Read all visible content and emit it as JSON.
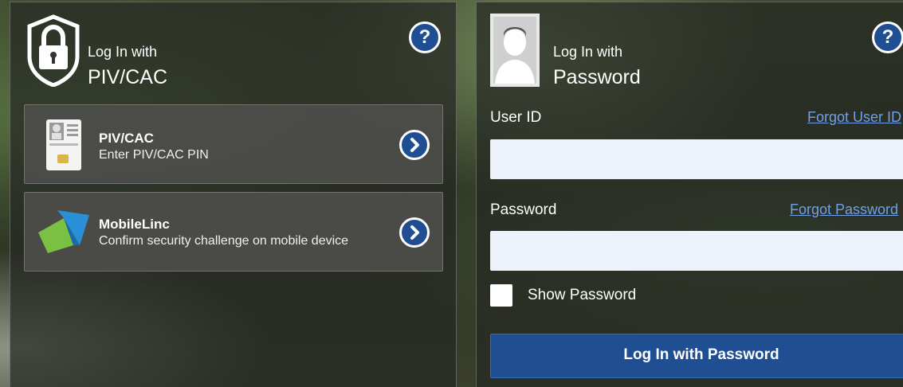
{
  "piv_panel": {
    "heading_small": "Log In with",
    "heading_large": "PIV/CAC",
    "help_icon": "?",
    "options": [
      {
        "title": "PIV/CAC",
        "description": "Enter PIV/CAC PIN",
        "icon": "piv-card-icon"
      },
      {
        "title": "MobileLinc",
        "description": "Confirm security challenge on mobile device",
        "icon": "mobilelinc-logo-icon"
      }
    ]
  },
  "password_panel": {
    "heading_small": "Log In with",
    "heading_large": "Password",
    "help_icon": "?",
    "user_id_label": "User ID",
    "forgot_user_id": "Forgot User ID",
    "user_id_value": "",
    "password_label": "Password",
    "forgot_password": "Forgot Password",
    "password_value": "",
    "show_password_label": "Show Password",
    "show_password_checked": false,
    "login_button": "Log In with Password"
  },
  "colors": {
    "accent_blue": "#1f4e93",
    "link_blue": "#6fa0e8",
    "input_bg": "#eef2fb",
    "mobilelinc_green": "#7ac143",
    "mobilelinc_blue": "#2a8fd6"
  }
}
